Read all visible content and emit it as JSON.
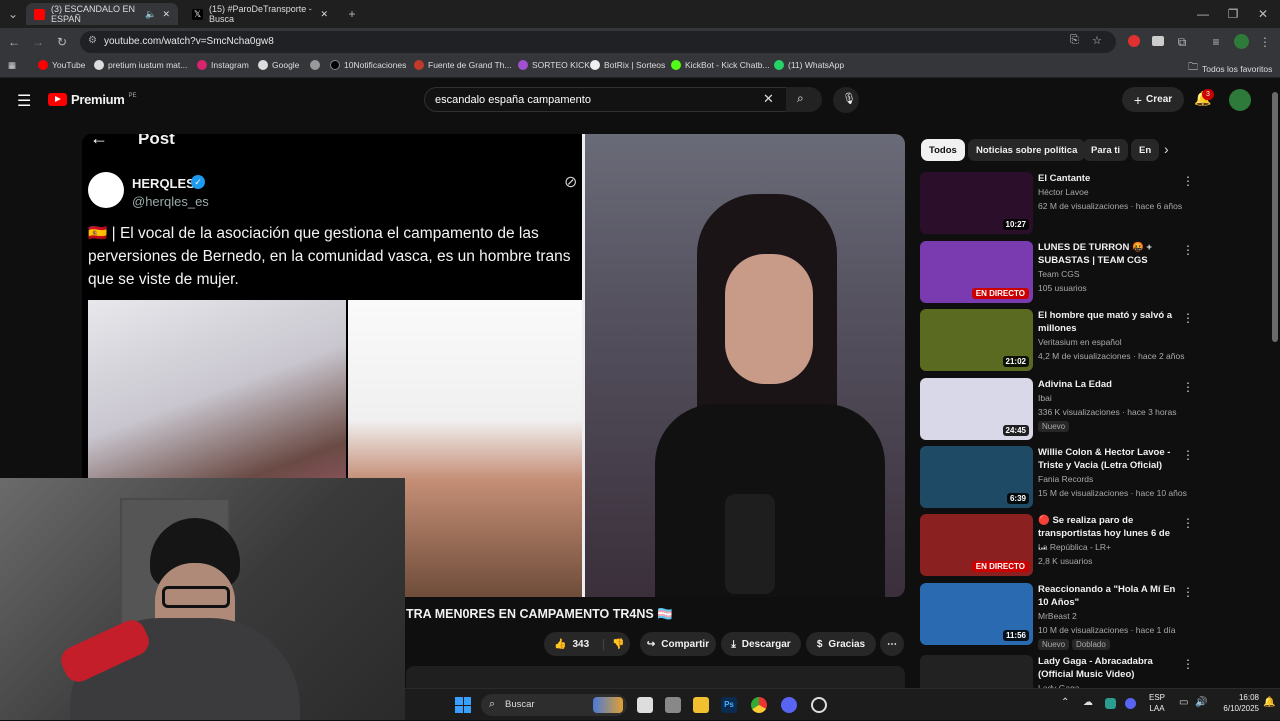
{
  "browser": {
    "tabs": [
      {
        "title": "(3) ESCANDALO EN ESPAÑ",
        "active": true
      },
      {
        "title": "(15) #ParoDeTransporte - Busca",
        "active": false
      }
    ],
    "new_tab": "+",
    "url": "youtube.com/watch?v=SmcNcha0gw8",
    "bookmarks": [
      "YouTube",
      "pretium iustum mat...",
      "Instagram",
      "Google",
      "",
      "10Notificaciones",
      "Fuente de Grand Th...",
      "SORTEO KICK",
      "BotRix | Sorteos",
      "KickBot - Kick Chatb...",
      "(11) WhatsApp"
    ],
    "all_favorites": "Todos los favoritos"
  },
  "youtube": {
    "logo": "Premium",
    "logo_region": "PE",
    "search_value": "escandalo españa campamento",
    "create_label": "Crear",
    "notifications_count": "3"
  },
  "video": {
    "post": {
      "header": "Post",
      "author_name": "HERQLES",
      "author_handle": "@herqles_es",
      "text": "🇪🇸 | El vocal de la asociación que gestiona el campamento de las perversiones de Bernedo, en la comunidad vasca, es un hombre trans que se viste de mujer."
    },
    "title": "TRA MEN0RES EN CAMPAMENTO TR4NS 🏳️‍⚧️",
    "likes": "343",
    "share_label": "Compartir",
    "download_label": "Descargar",
    "thanks_label": "Gracias"
  },
  "chips": [
    "Todos",
    "Noticias sobre política",
    "Para ti",
    "En"
  ],
  "recommendations": [
    {
      "title": "El Cantante",
      "channel": "Héctor Lavoe",
      "meta": "62 M de visualizaciones · hace 6 años",
      "duration": "10:27",
      "thumb": "#2b0f2a",
      "badge": ""
    },
    {
      "title": "LUNES DE TURRON 🤬 + SUBASTAS | TEAM CGS",
      "channel": "Team CGS",
      "meta": "105 usuarios",
      "duration": "EN DIRECTO",
      "thumb": "#7a3ab0",
      "badge": ""
    },
    {
      "title": "El hombre que mató y salvó a millones",
      "channel": "Veritasium en español",
      "meta": "4,2 M de visualizaciones · hace 2 años",
      "duration": "21:02",
      "thumb": "#5a6a20",
      "badge": ""
    },
    {
      "title": "Adivina La Edad",
      "channel": "Ibai",
      "meta": "336 K visualizaciones · hace 3 horas",
      "duration": "24:45",
      "thumb": "#d8d8e8",
      "badge": "Nuevo"
    },
    {
      "title": "Willie Colon & Hector Lavoe - Triste y Vacia (Letra Oficial)",
      "channel": "Fania Records",
      "meta": "15 M de visualizaciones · hace 10 años",
      "duration": "6:39",
      "thumb": "#1e4a66",
      "badge": ""
    },
    {
      "title": "🔴 Se realiza paro de transportistas hoy lunes 6 de ...",
      "channel": "La República - LR+",
      "meta": "2,8 K usuarios",
      "duration": "EN DIRECTO",
      "thumb": "#8a2020",
      "badge": ""
    },
    {
      "title": "Reaccionando a \"Hola A Mí En 10 Años\"",
      "channel": "MrBeast 2",
      "meta": "10 M de visualizaciones · hace 1 día",
      "duration": "11:56",
      "thumb": "#2a6ab0",
      "badge": "Nuevo",
      "badge2": "Doblado"
    },
    {
      "title": "Lady Gaga - Abracadabra (Official Music Video)",
      "channel": "Lady Gaga",
      "meta": "",
      "duration": "",
      "thumb": "#222",
      "badge": ""
    }
  ],
  "taskbar": {
    "search_label": "Buscar",
    "lang": "ESP",
    "region": "LAA",
    "time": "16:08",
    "date": "6/10/2025"
  }
}
